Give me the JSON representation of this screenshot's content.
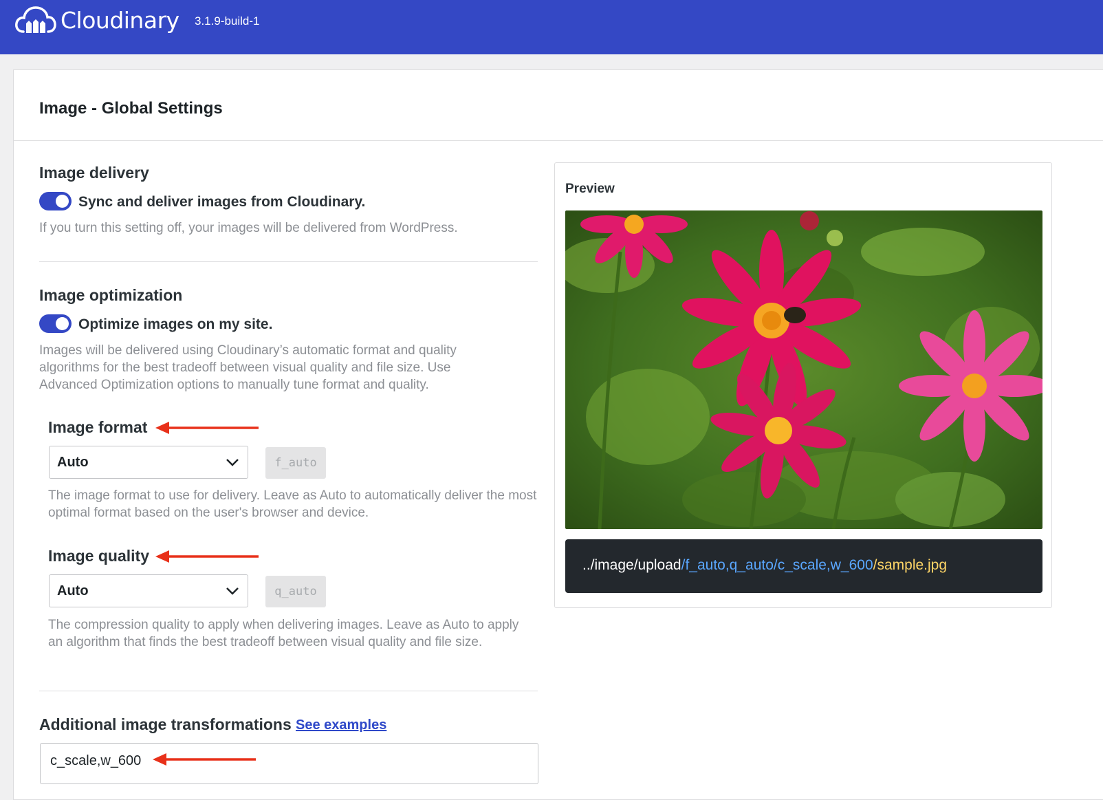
{
  "brand": {
    "name": "Cloudinary",
    "version": "3.1.9-build-1"
  },
  "page_title": "Image - Global Settings",
  "delivery": {
    "title": "Image delivery",
    "toggle_label": "Sync and deliver images from Cloudinary.",
    "enabled": true,
    "description": "If you turn this setting off, your images will be delivered from WordPress."
  },
  "optimization": {
    "title": "Image optimization",
    "toggle_label": "Optimize images on my site.",
    "enabled": true,
    "description": "Images will be delivered using Cloudinary’s automatic format and quality algorithms for the best tradeoff between visual quality and file size. Use Advanced Optimization options to manually tune format and quality."
  },
  "format": {
    "title": "Image format",
    "selected": "Auto",
    "code": "f_auto",
    "description": "The image format to use for delivery. Leave as Auto to automatically deliver the most optimal format based on the user's browser and device."
  },
  "quality": {
    "title": "Image quality",
    "selected": "Auto",
    "code": "q_auto",
    "description": "The compression quality to apply when delivering images. Leave as Auto to apply an algorithm that finds the best tradeoff between visual quality and file size."
  },
  "transformations": {
    "title": "Additional image transformations",
    "link": "See examples",
    "value": "c_scale,w_600"
  },
  "preview": {
    "title": "Preview",
    "url_base": "../image/upload",
    "url_transform": "/f_auto,q_auto/c_scale,w_600",
    "url_file": "/sample.jpg"
  },
  "colors": {
    "brand": "#3448c5",
    "annotation_arrow": "#e8311a",
    "url_transform": "#5aa7ff",
    "url_file": "#ffd667"
  }
}
